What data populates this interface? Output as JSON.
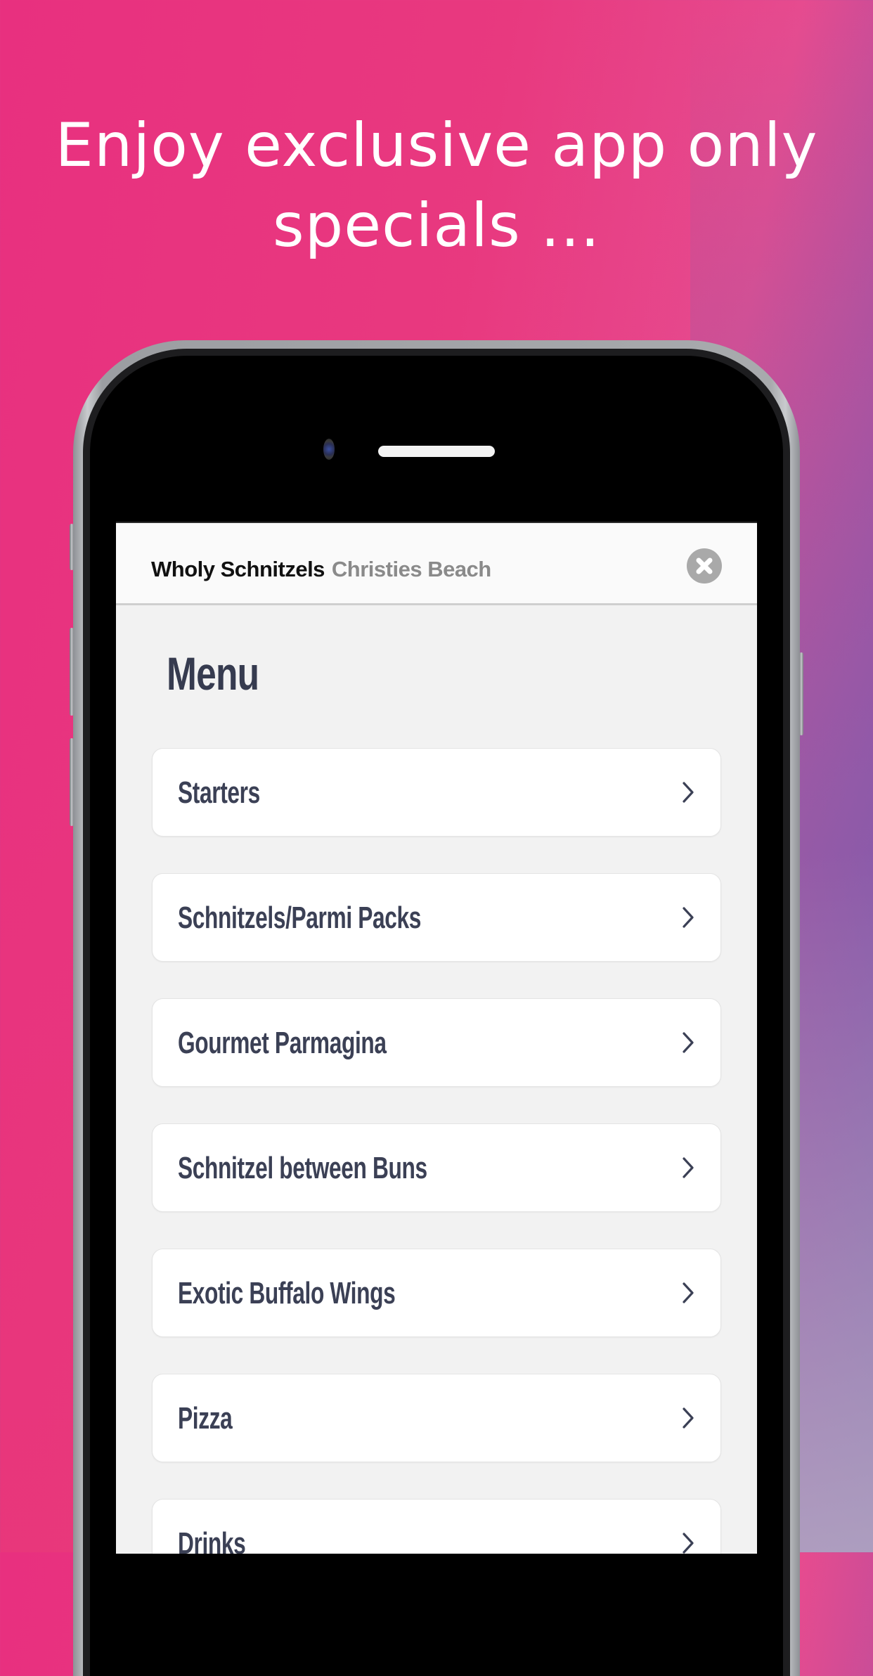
{
  "promo": {
    "headline_line1": "Enjoy exclusive app only",
    "headline_line2": "specials ..."
  },
  "colors": {
    "background_primary": "#e8307f",
    "background_secondary": "#7a64ad",
    "text_dark": "#363b4f",
    "text_muted": "#8a8a8a",
    "close_button": "#a9a9a9"
  },
  "app": {
    "header": {
      "restaurant_name": "Wholy Schnitzels",
      "location_name": "Christies Beach",
      "close_icon": "close-circle-icon"
    },
    "menu": {
      "title": "Menu",
      "categories": [
        {
          "label": "Starters",
          "icon": "chevron-right-icon"
        },
        {
          "label": "Schnitzels/Parmi Packs",
          "icon": "chevron-right-icon"
        },
        {
          "label": "Gourmet Parmagina",
          "icon": "chevron-right-icon"
        },
        {
          "label": "Schnitzel between Buns",
          "icon": "chevron-right-icon"
        },
        {
          "label": "Exotic Buffalo Wings",
          "icon": "chevron-right-icon"
        },
        {
          "label": "Pizza",
          "icon": "chevron-right-icon"
        },
        {
          "label": "Drinks",
          "icon": "chevron-right-icon"
        }
      ]
    }
  }
}
